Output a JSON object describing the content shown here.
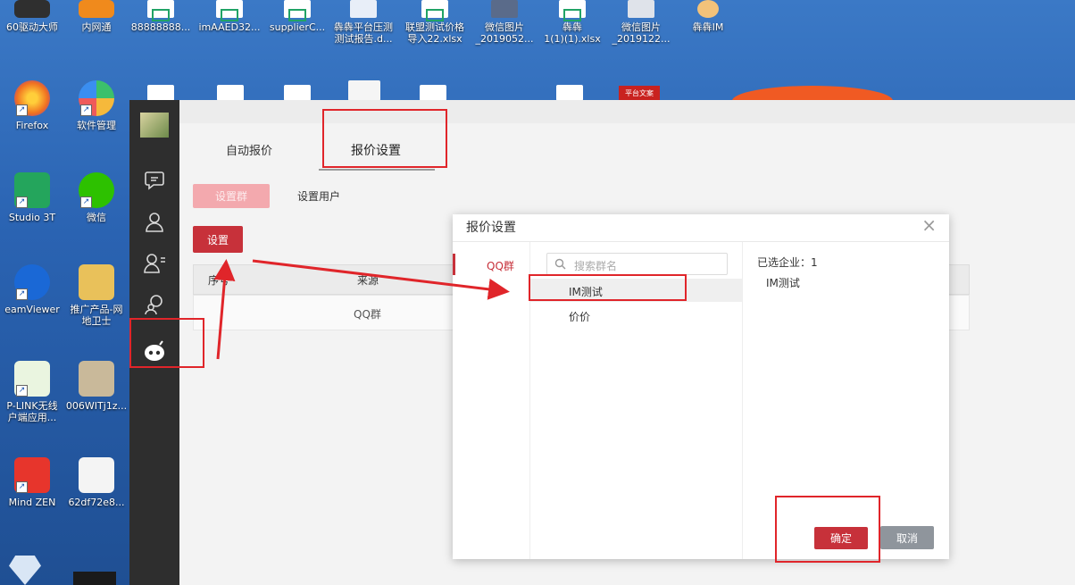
{
  "desktop": {
    "top_row": [
      "60驱动大师",
      "内网通",
      "88888888...",
      "imAAED32...",
      "supplierC...",
      "犇犇平台压测\n测试报告.d...",
      "联盟测试价格\n导入22.xlsx",
      "微信图片\n_2019052...",
      "犇犇\n1(1)(1).xlsx",
      "微信图片\n_2019122...",
      "犇犇IM"
    ],
    "left_col": [
      "Firefox",
      "软件管理",
      "Studio 3T",
      "微信",
      "eamViewer",
      "推广产品-网\n地卫士",
      "P-LINK无线\n户端应用...",
      "006WITj1z...",
      "Mind ZEN",
      "62df72e8..."
    ],
    "banner_label": "平台文案"
  },
  "tabs": {
    "auto": "自动报价",
    "settings": "报价设置"
  },
  "subtabs": {
    "group": "设置群",
    "user": "设置用户"
  },
  "set_button": "设置",
  "table": {
    "headers": [
      "序号",
      "来源"
    ],
    "row": {
      "source": "QQ群"
    }
  },
  "dialog": {
    "title": "报价设置",
    "close": "×",
    "left_item": "QQ群",
    "search_placeholder": "搜索群名",
    "groups": [
      "IM测试",
      "价价"
    ],
    "selected_label": "已选企业：1",
    "selected_items": [
      "IM测试"
    ],
    "confirm": "确定",
    "cancel": "取消"
  },
  "colors": {
    "accent": "#c7313a",
    "accent_light": "#f3a9ae",
    "annotation": "#e0252a"
  }
}
